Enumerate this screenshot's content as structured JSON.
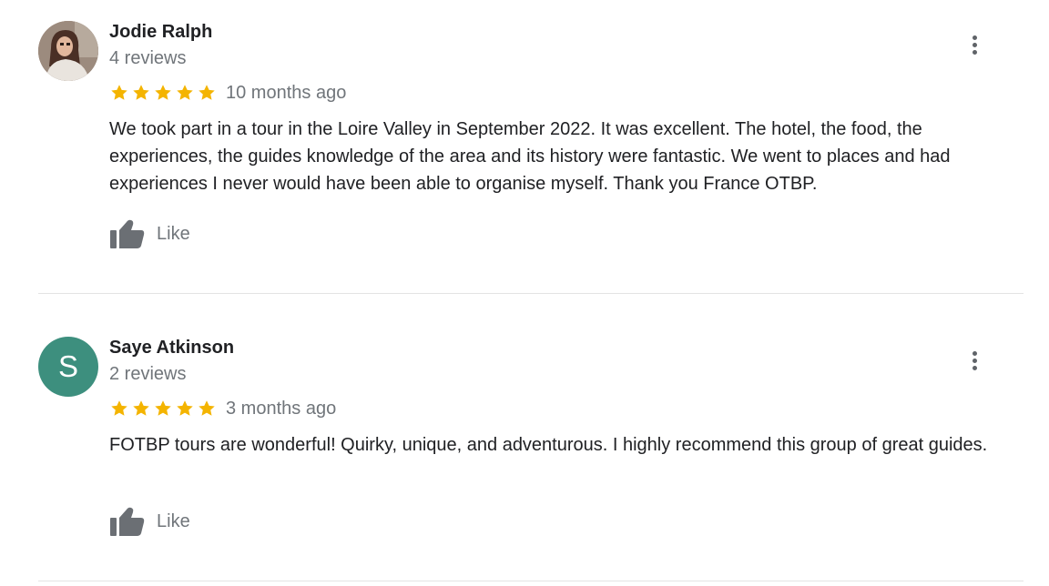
{
  "colors": {
    "star": "#f4b400",
    "secondary_text": "#70757a",
    "avatar_s_bg": "#3d8f7e"
  },
  "reviews": [
    {
      "name": "Jodie Ralph",
      "review_count": "4 reviews",
      "rating": 5,
      "time": "10 months ago",
      "text": "We took part in a tour in the Loire Valley in September 2022. It was excellent. The hotel, the food, the experiences, the guides knowledge of the area and its history were fantastic. We went to places and had experiences I never would have been able to organise myself. Thank you France OTBP.",
      "like_label": "Like",
      "avatar": "photo"
    },
    {
      "name": "Saye Atkinson",
      "review_count": "2 reviews",
      "rating": 5,
      "time": "3 months ago",
      "text": "FOTBP tours are wonderful! Quirky, unique, and adventurous. I highly recommend this group of great guides.",
      "like_label": "Like",
      "avatar": "letter",
      "avatar_letter": "S"
    }
  ],
  "icons": {
    "star": "star-icon",
    "like": "thumbs-up-icon",
    "more": "more-vert-icon"
  }
}
